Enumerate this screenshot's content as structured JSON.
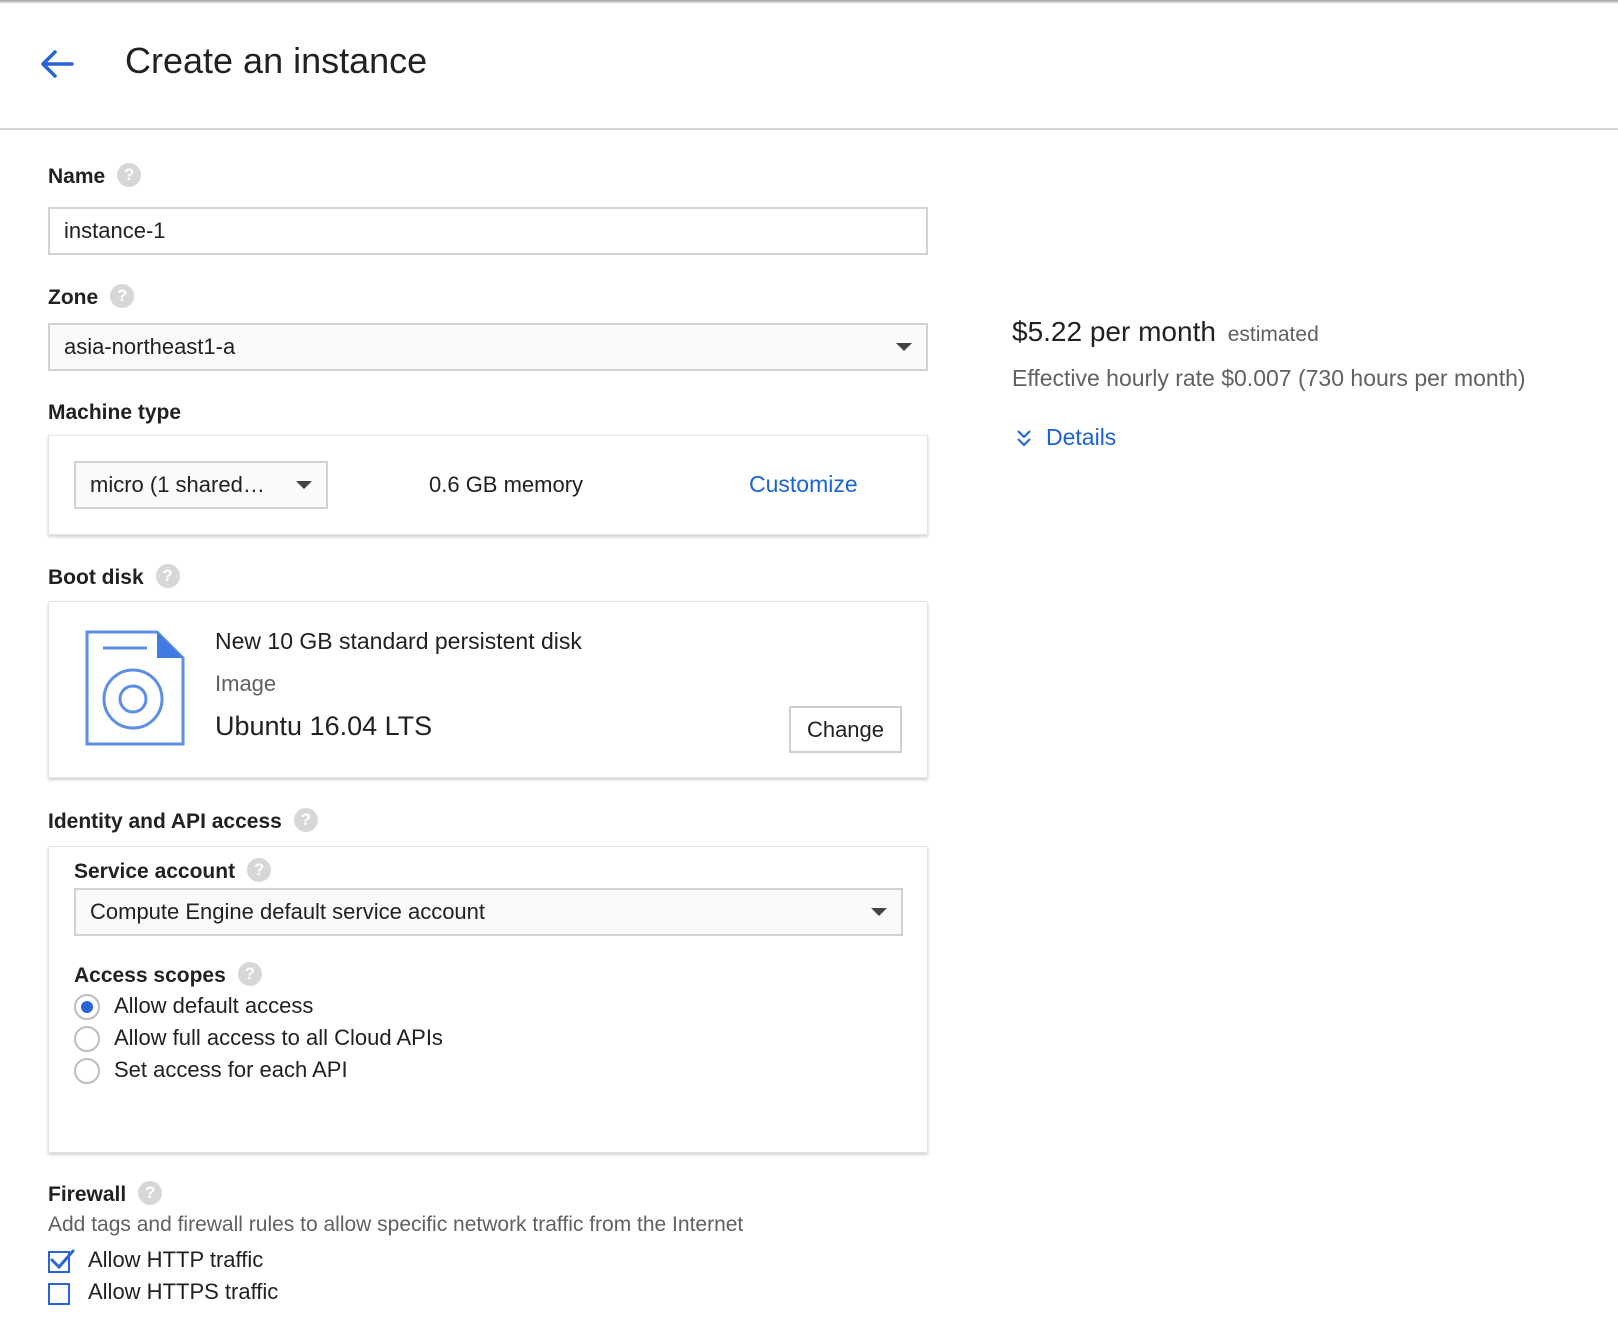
{
  "header": {
    "title": "Create an instance"
  },
  "name": {
    "label": "Name",
    "value": "instance-1"
  },
  "zone": {
    "label": "Zone",
    "value": "asia-northeast1-a"
  },
  "machine_type": {
    "label": "Machine type",
    "select_value": "micro (1 shared…",
    "memory": "0.6 GB memory",
    "customize": "Customize"
  },
  "boot_disk": {
    "label": "Boot disk",
    "disk": "New 10 GB standard persistent disk",
    "image_label": "Image",
    "image": "Ubuntu 16.04 LTS",
    "change": "Change"
  },
  "identity": {
    "label": "Identity and API access",
    "service_account_label": "Service account",
    "service_account_value": "Compute Engine default service account",
    "access_scopes_label": "Access scopes",
    "scopes": [
      {
        "label": "Allow default access",
        "selected": true
      },
      {
        "label": "Allow full access to all Cloud APIs",
        "selected": false
      },
      {
        "label": "Set access for each API",
        "selected": false
      }
    ]
  },
  "firewall": {
    "label": "Firewall",
    "description": "Add tags and firewall rules to allow specific network traffic from the Internet",
    "options": [
      {
        "label": "Allow HTTP traffic",
        "checked": true
      },
      {
        "label": "Allow HTTPS traffic",
        "checked": false
      }
    ]
  },
  "pricing": {
    "price": "$5.22 per month",
    "estimated": "estimated",
    "hourly": "Effective hourly rate $0.007 (730 hours per month)",
    "details": "Details"
  },
  "colors": {
    "accent": "#1a63d6",
    "muted": "#616161",
    "border": "#d2d2d2"
  }
}
